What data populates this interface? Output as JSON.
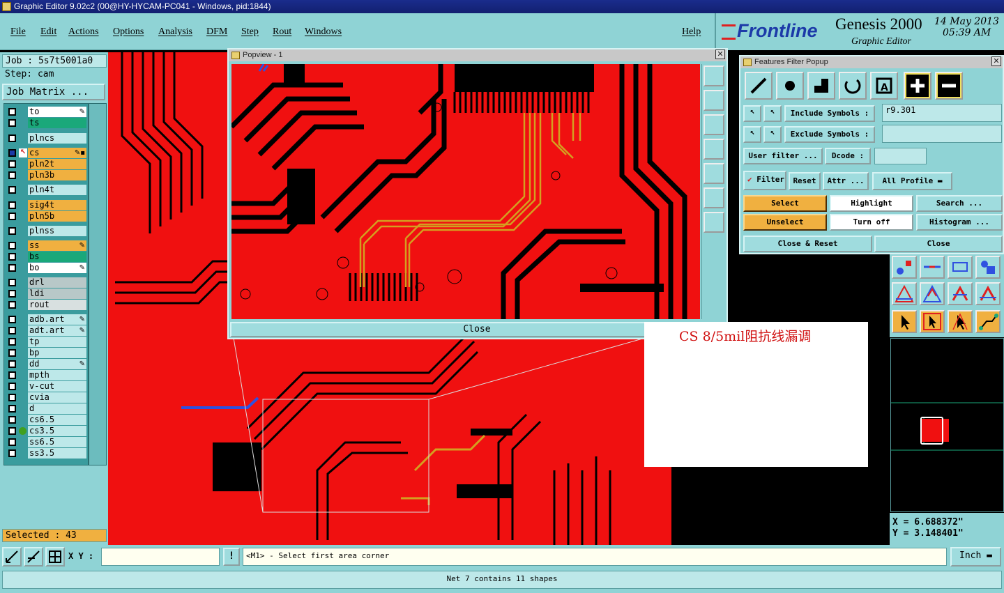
{
  "window": {
    "title": "Graphic Editor 9.02c2 (00@HY-HYCAM-PC041 - Windows, pid:1844)"
  },
  "menu": {
    "items": [
      "File",
      "Edit",
      "Actions",
      "Options",
      "Analysis",
      "DFM",
      "Step",
      "Rout",
      "Windows"
    ],
    "help": "Help"
  },
  "brand": {
    "logo": "Frontline",
    "product": "Genesis 2000",
    "subtitle": "Graphic Editor",
    "date": "14 May 2013",
    "time": "05:39 AM"
  },
  "job": {
    "job": "Job : 5s7t5001a0",
    "step": "Step: cam",
    "matrix_button": "Job Matrix ..."
  },
  "layers": [
    {
      "name": "to",
      "color": "#ffffff",
      "mark": "✎"
    },
    {
      "name": "ts",
      "color": "#1aa87a",
      "mark": ""
    },
    {
      "name": "plncs",
      "color": "#bde8e9",
      "mark": ""
    },
    {
      "name": "cs",
      "color": "#f0b040",
      "mark": "✎▪"
    },
    {
      "name": "pln2t",
      "color": "#f0b040",
      "mark": ""
    },
    {
      "name": "pln3b",
      "color": "#f0b040",
      "mark": ""
    },
    {
      "name": "pln4t",
      "color": "#bde8e9",
      "mark": ""
    },
    {
      "name": "sig4t",
      "color": "#f0b040",
      "mark": ""
    },
    {
      "name": "pln5b",
      "color": "#f0b040",
      "mark": ""
    },
    {
      "name": "plnss",
      "color": "#bde8e9",
      "mark": ""
    },
    {
      "name": "ss",
      "color": "#f0b040",
      "mark": "✎"
    },
    {
      "name": "bs",
      "color": "#1aa87a",
      "mark": ""
    },
    {
      "name": "bo",
      "color": "#ffffff",
      "mark": "✎"
    },
    {
      "name": "drl",
      "color": "#b8c8c8",
      "mark": ""
    },
    {
      "name": "ldi",
      "color": "#b8c8c8",
      "mark": ""
    },
    {
      "name": "rout",
      "color": "#d8e0e0",
      "mark": ""
    },
    {
      "name": "adb.art",
      "color": "#bde8e9",
      "mark": "✎"
    },
    {
      "name": "adt.art",
      "color": "#bde8e9",
      "mark": "✎"
    },
    {
      "name": "tp",
      "color": "#bde8e9",
      "mark": ""
    },
    {
      "name": "bp",
      "color": "#bde8e9",
      "mark": ""
    },
    {
      "name": "dd",
      "color": "#bde8e9",
      "mark": "✎"
    },
    {
      "name": "mpth",
      "color": "#bde8e9",
      "mark": ""
    },
    {
      "name": "v-cut",
      "color": "#bde8e9",
      "mark": ""
    },
    {
      "name": "cvia",
      "color": "#bde8e9",
      "mark": ""
    },
    {
      "name": "d",
      "color": "#bde8e9",
      "mark": ""
    },
    {
      "name": "cs6.5",
      "color": "#bde8e9",
      "mark": ""
    },
    {
      "name": "cs3.5",
      "color": "#bde8e9",
      "mark": ""
    },
    {
      "name": "ss6.5",
      "color": "#bde8e9",
      "mark": ""
    },
    {
      "name": "ss3.5",
      "color": "#bde8e9",
      "mark": ""
    }
  ],
  "selected": "Selected : 43",
  "popview": {
    "title": "Popview - 1",
    "close": "Close"
  },
  "filter": {
    "title": "Features Filter Popup",
    "include_label": "Include Symbols :",
    "include_value": "r9.301",
    "exclude_label": "Exclude Symbols :",
    "exclude_value": "",
    "user_filter": "User filter ...",
    "dcode": "Dcode :",
    "dcode_value": "",
    "filter_label": "Filter",
    "reset": "Reset",
    "attr": "Attr ...",
    "profile": "All Profile",
    "select": "Select",
    "highlight": "Highlight",
    "search": "Search ...",
    "unselect": "Unselect",
    "turn_off": "Turn off",
    "histogram": "Histogram ...",
    "close_reset": "Close & Reset",
    "close": "Close"
  },
  "note": {
    "text": "CS 8/5mil阻抗线漏调"
  },
  "coords": {
    "x": "X = 6.688372\"",
    "y": "Y = 3.148401\""
  },
  "status": {
    "xy_label": "X Y :",
    "xy_value": "",
    "prompt": "<M1> - Select first area corner",
    "units": "Inch"
  },
  "message": "Net 7 contains 11 shapes",
  "colors": {
    "copper": "#f01010",
    "panel": "#8fd3d5",
    "selected_trace": "#d4a020"
  }
}
